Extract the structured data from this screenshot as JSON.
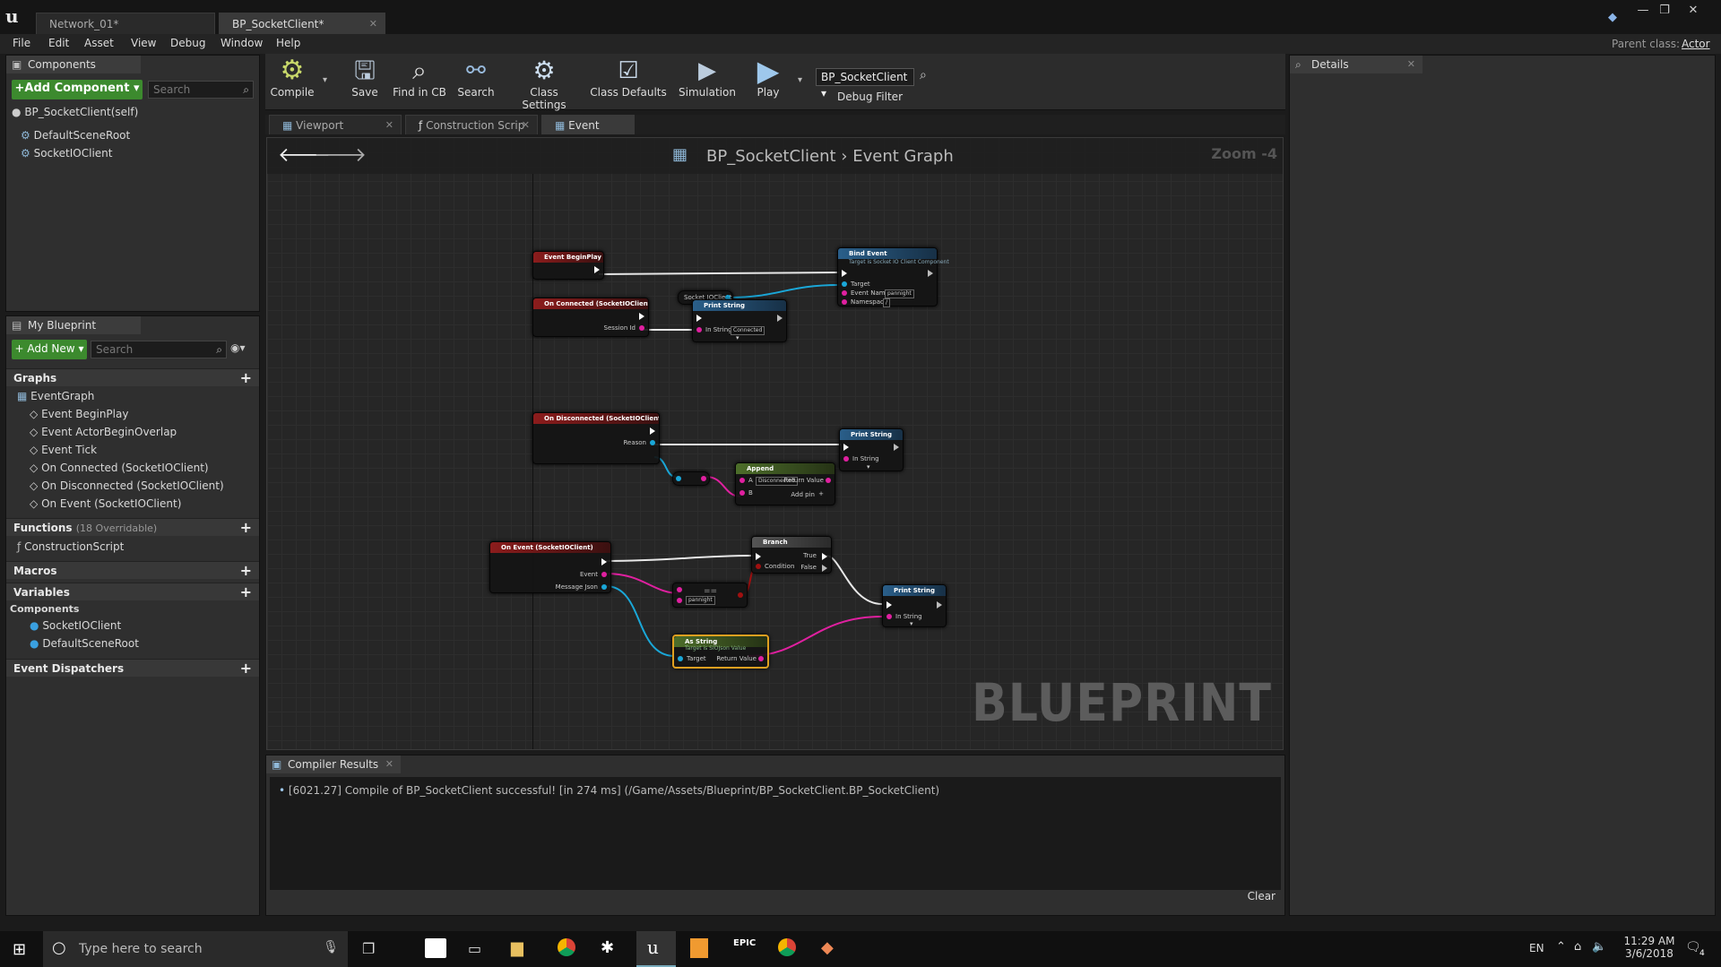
{
  "window": {
    "tabs": [
      {
        "label": "Network_01*"
      },
      {
        "label": "BP_SocketClient*"
      }
    ],
    "parent_class_label": "Parent class:",
    "parent_class_value": "Actor"
  },
  "menu": [
    "File",
    "Edit",
    "Asset",
    "View",
    "Debug",
    "Window",
    "Help"
  ],
  "components_panel": {
    "tab": "Components",
    "add_button": "+Add Component",
    "search_placeholder": "Search",
    "self_item": "BP_SocketClient(self)",
    "items": [
      "DefaultSceneRoot",
      "SocketIOClient"
    ]
  },
  "my_blueprint": {
    "tab": "My Blueprint",
    "add_button": "+ Add New",
    "search_placeholder": "Search",
    "graphs_header": "Graphs",
    "event_graph": "EventGraph",
    "events": [
      "Event BeginPlay",
      "Event ActorBeginOverlap",
      "Event Tick",
      "On Connected (SocketIOClient)",
      "On Disconnected (SocketIOClient)",
      "On Event (SocketIOClient)"
    ],
    "functions_header": "Functions",
    "functions_note": "(18 Overridable)",
    "construction_script": "ConstructionScript",
    "macros_header": "Macros",
    "variables_header": "Variables",
    "components_header": "Components",
    "component_vars": [
      "SocketIOClient",
      "DefaultSceneRoot"
    ],
    "event_dispatchers_header": "Event Dispatchers"
  },
  "toolbar": {
    "buttons": [
      "Compile",
      "Save",
      "Find in CB",
      "Search",
      "Class Settings",
      "Class Defaults",
      "Simulation",
      "Play"
    ],
    "debug_object": "BP_SocketClient",
    "debug_filter": "Debug Filter"
  },
  "editor_tabs": [
    "Viewport",
    "Construction Scrip",
    "Event Graph"
  ],
  "graph": {
    "breadcrumb_root": "BP_SocketClient",
    "breadcrumb_current": "Event Graph",
    "zoom": "Zoom -4",
    "watermark": "BLUEPRINT",
    "nodes": {
      "begin_play": "Event BeginPlay",
      "bind_event": "Bind Event",
      "bind_event_sub": "Target is Socket IO Client Component",
      "bind_target": "Target",
      "bind_event_name": "Event Name",
      "bind_event_name_val": "pannight",
      "bind_namespace": "Namespace",
      "bind_namespace_val": "/",
      "socket_var": "Socket IOClient",
      "on_connected": "On Connected (SocketIOClient)",
      "session_id": "Session Id",
      "print1": "Print String",
      "in_string": "In String",
      "print1_val": "Connected",
      "on_disconnected": "On Disconnected (SocketIOClient)",
      "reason": "Reason",
      "print2": "Print String",
      "append": "Append",
      "append_a": "A",
      "append_a_val": "Disconnected",
      "append_b": "B",
      "return_value": "Return Value",
      "add_pin": "Add pin",
      "on_event": "On Event (SocketIOClient)",
      "event_pin": "Event",
      "message_json": "Message Json",
      "branch": "Branch",
      "condition": "Condition",
      "true_label": "True",
      "false_label": "False",
      "eq_val": "pannight",
      "eq_op": "==",
      "as_string": "As String",
      "as_string_sub": "Target is SIOJson Value",
      "target": "Target",
      "print3": "Print String"
    }
  },
  "details_panel": {
    "tab": "Details"
  },
  "compiler": {
    "tab": "Compiler Results",
    "message": "[6021.27] Compile of BP_SocketClient successful! [in 274 ms] (/Game/Assets/Blueprint/BP_SocketClient.BP_SocketClient)",
    "clear": "Clear"
  },
  "taskbar": {
    "search_placeholder": "Type here to search",
    "lang": "EN",
    "time": "11:29 AM",
    "date": "3/6/2018",
    "notifications": "4"
  },
  "colors": {
    "accent_green": "#3c8a2e",
    "event_red": "#8c1c1c",
    "function_blue": "#2a5f8a",
    "exec_white": "#ffffff",
    "string_pink": "#e020a0",
    "object_cyan": "#1aa7d8"
  }
}
